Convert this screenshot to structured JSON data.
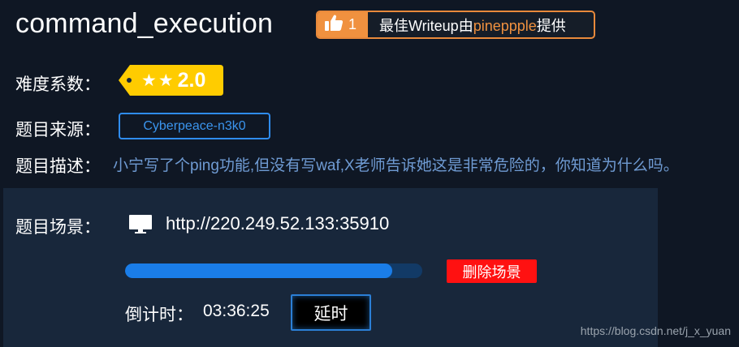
{
  "challenge": {
    "title": "command_execution",
    "writeup_badge": {
      "like_count": "1",
      "text_prefix": "最佳Writeup由",
      "author": "pineppple",
      "text_suffix": "提供",
      "thumb_icon": "thumbs-up-icon"
    },
    "difficulty": {
      "label": "难度系数：",
      "stars": 2,
      "star_glyph": "★",
      "score": "2.0",
      "tag_color": "#ffcc00"
    },
    "source": {
      "label": "题目来源：",
      "value": "Cyberpeace-n3k0"
    },
    "description": {
      "label": "题目描述：",
      "text": "小宁写了个ping功能,但没有写waf,X老师告诉她这是非常危险的，你知道为什么吗。"
    }
  },
  "scene": {
    "label": "题目场景：",
    "icon": "monitor-icon",
    "url": "http://220.249.52.133:35910",
    "progress_fraction": 0.9,
    "delete_label": "删除场景",
    "countdown_label": "倒计时：",
    "countdown_value": "03:36:25",
    "extend_label": "延时"
  },
  "watermark": "https://blog.csdn.net/j_x_yuan",
  "colors": {
    "accent_orange": "#f0913f",
    "accent_blue": "#2f8cf0",
    "delete_red": "#ff1111",
    "description_blue": "#6f9bd3"
  }
}
